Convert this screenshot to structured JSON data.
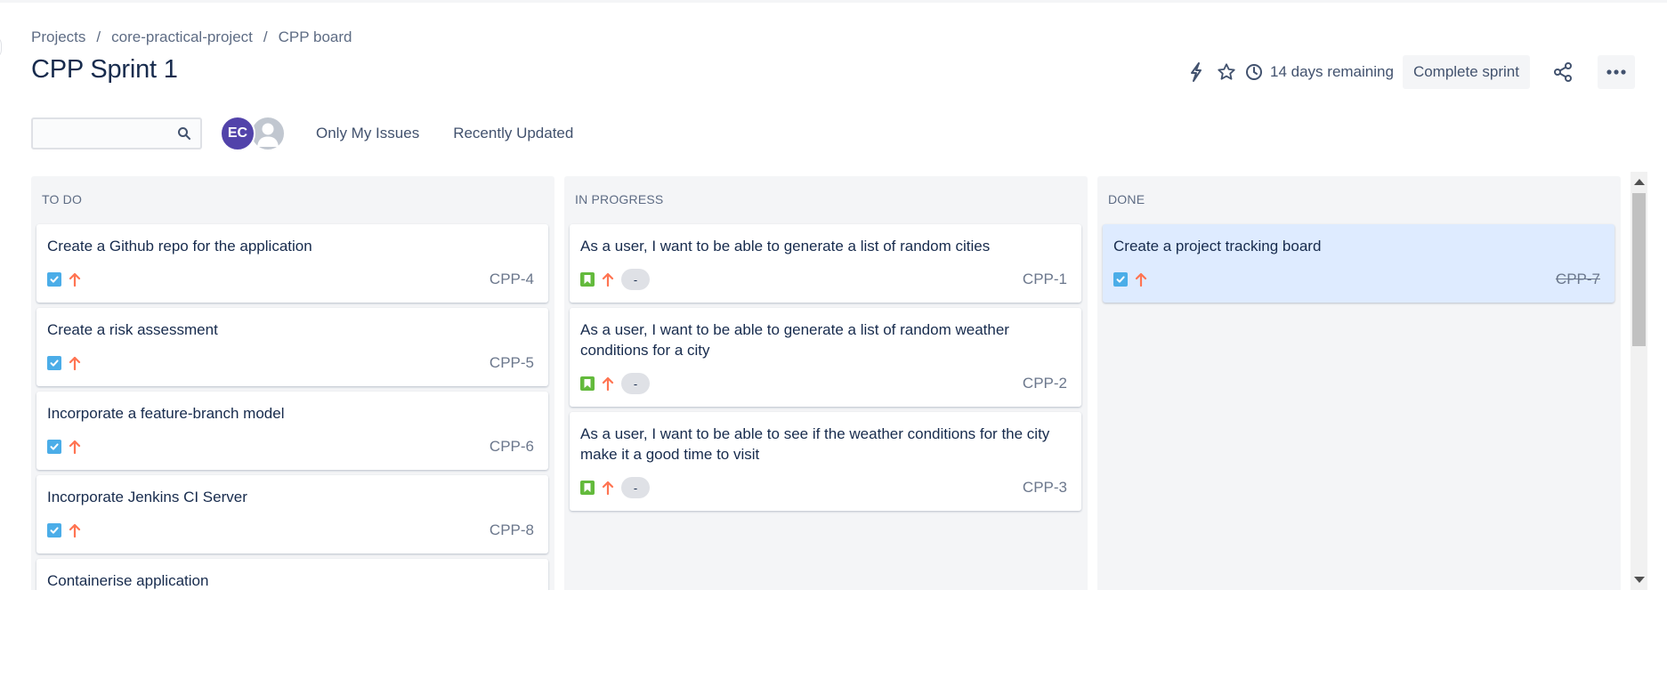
{
  "breadcrumb": {
    "items": [
      "Projects",
      "core-practical-project",
      "CPP board"
    ],
    "separator": "/"
  },
  "sprint": {
    "title": "CPP Sprint 1",
    "remaining": "14 days remaining",
    "complete_label": "Complete sprint"
  },
  "header_icons": [
    "automation-icon",
    "star-icon",
    "clock-icon",
    "share-icon",
    "more-icon"
  ],
  "filters": {
    "search_placeholder": "",
    "avatar_initials": "EC",
    "quick_filters": [
      "Only My Issues",
      "Recently Updated"
    ]
  },
  "colors": {
    "task_blue": "#4bade8",
    "story_green": "#63ba3c",
    "priority_orange": "#ff7452",
    "avatar_purple": "#5243aa",
    "selected_card": "#deebff"
  },
  "columns": [
    {
      "name": "TO DO",
      "cards": [
        {
          "summary": "Create a Github repo for the application",
          "key": "CPP-4",
          "type": "task",
          "priority": "high"
        },
        {
          "summary": "Create a risk assessment",
          "key": "CPP-5",
          "type": "task",
          "priority": "high"
        },
        {
          "summary": "Incorporate a feature-branch model",
          "key": "CPP-6",
          "type": "task",
          "priority": "high"
        },
        {
          "summary": "Incorporate Jenkins CI Server",
          "key": "CPP-8",
          "type": "task",
          "priority": "high"
        },
        {
          "summary": "Containerise application",
          "key": "",
          "type": "task",
          "priority": "high"
        }
      ]
    },
    {
      "name": "IN PROGRESS",
      "cards": [
        {
          "summary": "As a user, I want to be able to generate a list of random cities",
          "key": "CPP-1",
          "type": "story",
          "priority": "high",
          "epic": "-"
        },
        {
          "summary": "As a user, I want to be able to generate a list of random weather conditions for a city",
          "key": "CPP-2",
          "type": "story",
          "priority": "high",
          "epic": "-"
        },
        {
          "summary": "As a user, I want to be able to see if the weather conditions for the city make it a good time to visit",
          "key": "CPP-3",
          "type": "story",
          "priority": "high",
          "epic": "-"
        }
      ]
    },
    {
      "name": "DONE",
      "cards": [
        {
          "summary": "Create a project tracking board",
          "key": "CPP-7",
          "type": "task",
          "priority": "high",
          "done": true
        }
      ]
    }
  ]
}
